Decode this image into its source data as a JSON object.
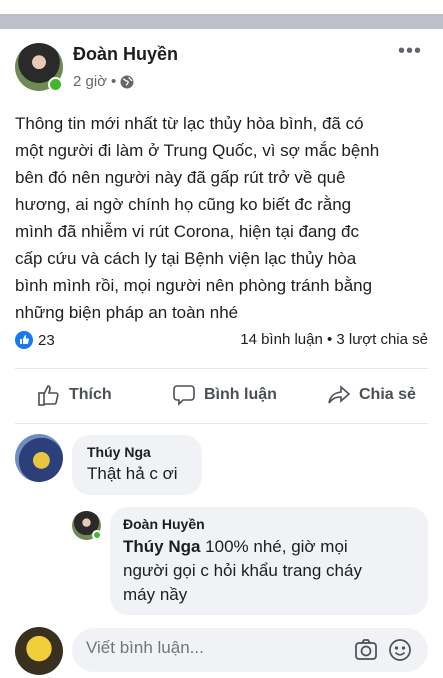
{
  "post": {
    "author": "Đoàn Huyền",
    "time": "2 giờ",
    "separator": "•",
    "body_lines": [
      "Thông tin mới nhất từ lạc thủy hòa bình, đã có",
      "một người đi làm ở Trung Quốc, vì sợ mắc bệnh",
      "bên đó nên người này đã gấp rút trở về quê",
      "hương, ai ngờ chính họ cũng ko biết đc rằng",
      "mình đã nhiễm vi rút Corona, hiện tại đang đc",
      "cấp cứu và cách ly tại Bệnh viện lạc thủy  hòa",
      "bình mình rồi, mọi người nên phòng tránh bằng",
      "những biện pháp an toàn nhé"
    ],
    "like_count": "23",
    "comments_count": "14 bình luận",
    "shares_count": "3 lượt chia sẻ"
  },
  "actions": {
    "like": "Thích",
    "comment": "Bình luận",
    "share": "Chia sẻ"
  },
  "comments": [
    {
      "author": "Thúy Nga",
      "text": "Thật hả c ơi"
    },
    {
      "author": "Đoàn Huyền",
      "mention": "Thúy Nga",
      "text_lines": [
        " 100% nhé, giờ mọi",
        "người gọi c hỏi khẩu trang cháy",
        "máy nầy"
      ]
    }
  ],
  "composer": {
    "placeholder": "Viết bình luận..."
  },
  "colors": {
    "like_blue": "#1877f2",
    "online_green": "#42b72a",
    "bubble": "#f0f2f5"
  }
}
